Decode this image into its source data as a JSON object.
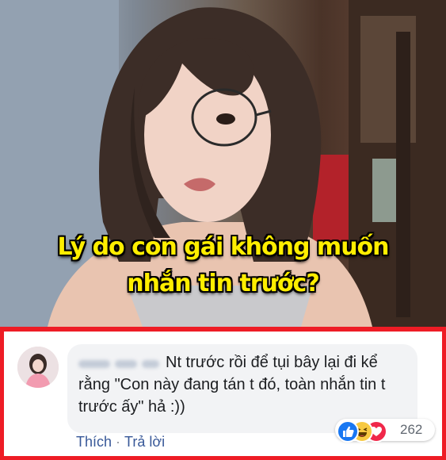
{
  "meme": {
    "caption_line1": "Lý do con gái không muốn",
    "caption_line2": "nhắn tin trước?"
  },
  "comment": {
    "text": "Nt trước rồi để tụi bây lại đi kể rằng \"Con này đang tán t đó, toàn nhắn tin t trước ấy\" hả :))",
    "reaction_count": "262",
    "reactions": [
      "like-icon",
      "haha-icon",
      "love-icon"
    ],
    "actions": {
      "like_label": "Thích",
      "separator": "·",
      "reply_label": "Trả lời"
    }
  },
  "colors": {
    "frame_border": "#ee1c25",
    "caption": "#ffee00",
    "link": "#385898",
    "bubble": "#f2f3f5"
  }
}
